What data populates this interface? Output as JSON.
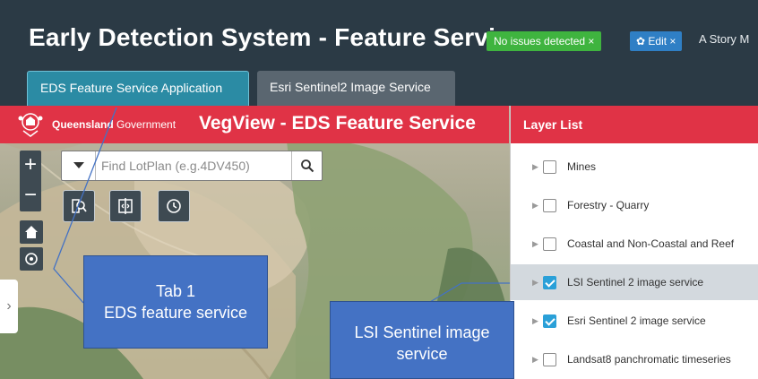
{
  "header": {
    "title": "Early Detection System - Feature Service",
    "status_badge": "No issues detected ×",
    "edit_badge": "✿ Edit ×",
    "story_text": "A Story M"
  },
  "tabs": [
    {
      "label": "EDS Feature Service Application",
      "active": true
    },
    {
      "label": "Esri Sentinel2 Image Service",
      "active": false
    }
  ],
  "banner": {
    "org_bold": "Queensland",
    "org_rest": "Government",
    "app_title": "VegView - EDS Feature Service",
    "color": "#e03346"
  },
  "map_tools": {
    "zoom_in": "+",
    "zoom_out": "−",
    "expand": "›"
  },
  "search": {
    "placeholder": "Find LotPlan (e.g.4DV450)"
  },
  "layer_list": {
    "title": "Layer List",
    "items": [
      {
        "label": "Mines",
        "checked": false
      },
      {
        "label": "Forestry - Quarry",
        "checked": false
      },
      {
        "label": "Coastal and Non-Coastal and Reef",
        "checked": false
      },
      {
        "label": "LSI Sentinel 2 image service",
        "checked": true,
        "selected": true
      },
      {
        "label": "Esri Sentinel 2 image service",
        "checked": true
      },
      {
        "label": "Landsat8 panchromatic timeseries",
        "checked": false
      }
    ]
  },
  "callouts": {
    "tab1_line1": "Tab 1",
    "tab1_line2": "EDS feature service",
    "lsi_line1": "LSI Sentinel image",
    "lsi_line2": "service"
  },
  "colors": {
    "header_bg": "#2b3a45",
    "active_tab": "#2b8ba4",
    "callout": "#4472c4",
    "checkbox_on": "#2aa0d8"
  }
}
